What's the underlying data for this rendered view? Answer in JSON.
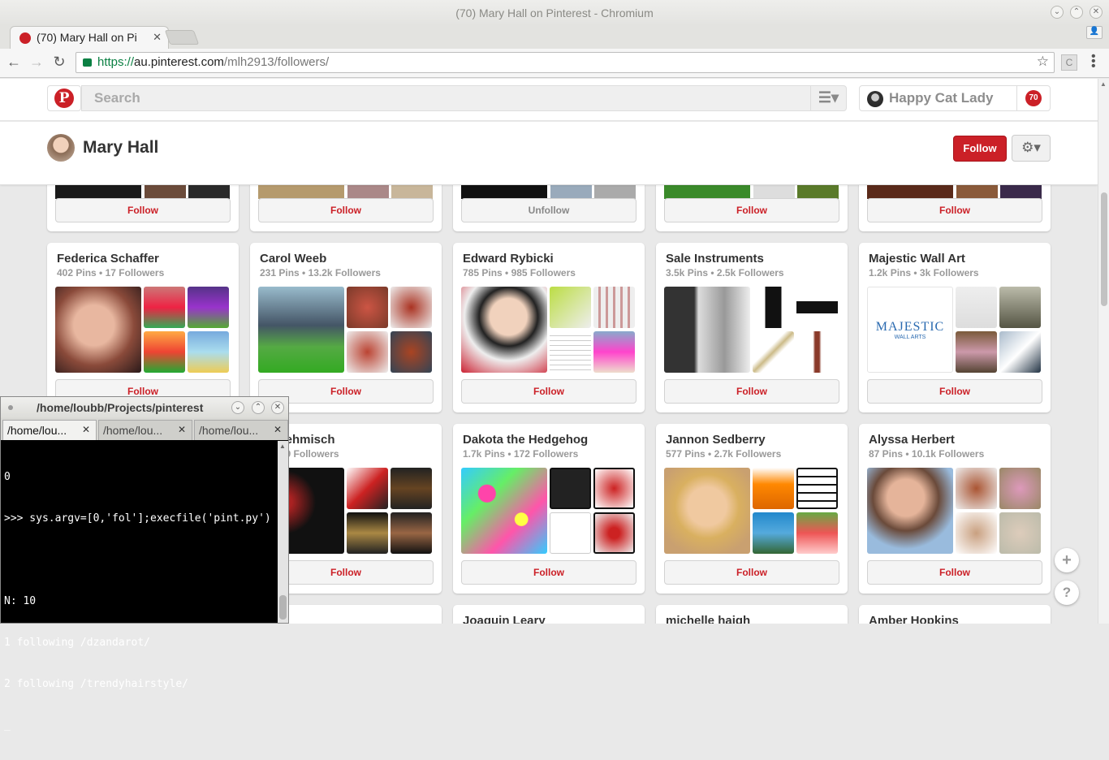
{
  "window": {
    "title": "(70) Mary Hall on Pinterest - Chromium"
  },
  "tab": {
    "label": "(70) Mary Hall on Pi"
  },
  "omnibox": {
    "scheme": "https://",
    "host": "au.pinterest.com",
    "path": "/mlh2913/followers/"
  },
  "header": {
    "search_placeholder": "Search",
    "user_name": "Happy Cat Lady",
    "notif_count": "70"
  },
  "profile": {
    "name": "Mary Hall",
    "follow_label": "Follow"
  },
  "colors": {
    "accent": "#cb2027"
  },
  "top_row_buttons": [
    "Follow",
    "Follow",
    "Unfollow",
    "Follow",
    "Follow"
  ],
  "row2": [
    {
      "name": "Federica Schaffer",
      "stats": "402 Pins • 17 Followers",
      "button": "Follow"
    },
    {
      "name": "Carol Weeb",
      "stats": "231 Pins • 13.2k Followers",
      "button": "Follow"
    },
    {
      "name": "Edward Rybicki",
      "stats": "785 Pins • 985 Followers",
      "button": "Follow"
    },
    {
      "name": "Sale Instruments",
      "stats": "3.5k Pins • 2.5k Followers",
      "button": "Follow"
    },
    {
      "name": "Majestic Wall Art",
      "stats": "1.2k Pins • 3k Followers",
      "button": "Follow",
      "logo_text": "MAJESTIC",
      "logo_sub": "WALL ARTS"
    }
  ],
  "row3": [
    {
      "name": "ne Sehmisch",
      "stats": "ns • 29 Followers",
      "button": "Follow"
    },
    {
      "name": "Dakota the Hedgehog",
      "stats": "1.7k Pins • 172 Followers",
      "button": "Follow"
    },
    {
      "name": "Jannon Sedberry",
      "stats": "577 Pins • 2.7k Followers",
      "button": "Follow"
    },
    {
      "name": "Alyssa Herbert",
      "stats": "87 Pins • 10.1k Followers",
      "button": "Follow"
    }
  ],
  "row4": [
    {
      "name": "Joaquin Leary"
    },
    {
      "name": "michelle haigh"
    },
    {
      "name": "Amber Hopkins"
    }
  ],
  "terminal": {
    "title": "/home/loubb/Projects/pinterest",
    "tabs": [
      "/home/lou...",
      "/home/lou...",
      "/home/lou..."
    ],
    "lines": [
      "0",
      ">>> sys.argv=[0,'fol'];execfile('pint.py')",
      "",
      "N: 10",
      "1 following /dzandarot/",
      "2 following /trendyhairstyle/",
      "_"
    ]
  }
}
